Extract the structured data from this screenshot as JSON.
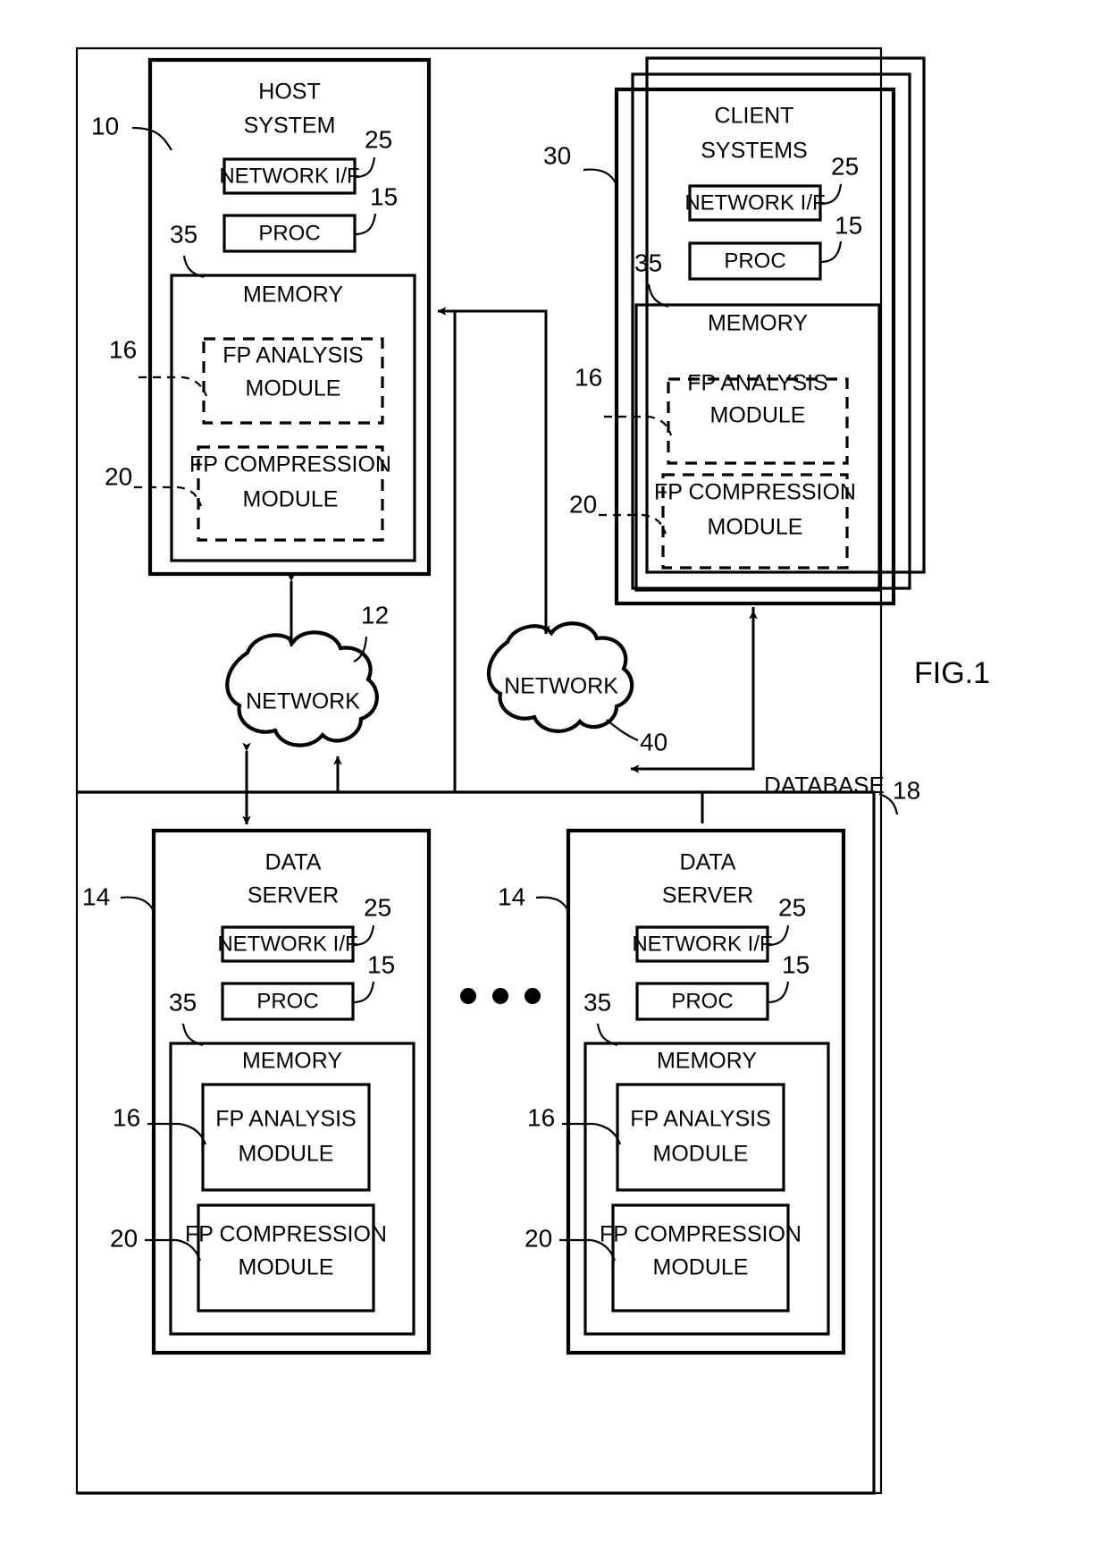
{
  "figure": {
    "label": "FIG.1",
    "outer_ref": "10",
    "database_label": "DATABASE",
    "database_ref": "18"
  },
  "nodes": {
    "host": {
      "title_line1": "HOST",
      "title_line2": "SYSTEM",
      "ref": "10",
      "network_if": {
        "label": "NETWORK I/F",
        "ref": "25"
      },
      "proc": {
        "label": "PROC",
        "ref": "15"
      },
      "memory": {
        "label": "MEMORY",
        "ref": "35",
        "modules": [
          {
            "line1": "FP ANALYSIS",
            "line2": "MODULE",
            "ref": "16",
            "border": "dashed"
          },
          {
            "line1": "FP COMPRESSION",
            "line2": "MODULE",
            "ref": "20",
            "border": "dashed"
          }
        ]
      }
    },
    "client": {
      "title_line1": "CLIENT",
      "title_line2": "SYSTEMS",
      "ref": "30",
      "network_if": {
        "label": "NETWORK I/F",
        "ref": "25"
      },
      "proc": {
        "label": "PROC",
        "ref": "15"
      },
      "memory": {
        "label": "MEMORY",
        "ref": "35",
        "modules": [
          {
            "line1": "FP ANALYSIS",
            "line2": "MODULE",
            "ref": "16",
            "border": "dashed"
          },
          {
            "line1": "FP COMPRESSION",
            "line2": "MODULE",
            "ref": "20",
            "border": "dashed"
          }
        ]
      }
    },
    "data_server_left": {
      "title_line1": "DATA",
      "title_line2": "SERVER",
      "ref": "14",
      "network_if": {
        "label": "NETWORK I/F",
        "ref": "25"
      },
      "proc": {
        "label": "PROC",
        "ref": "15"
      },
      "memory": {
        "label": "MEMORY",
        "ref": "35",
        "modules": [
          {
            "line1": "FP ANALYSIS",
            "line2": "MODULE",
            "ref": "16",
            "border": "solid"
          },
          {
            "line1": "FP COMPRESSION",
            "line2": "MODULE",
            "ref": "20",
            "border": "solid"
          }
        ]
      }
    },
    "data_server_right": {
      "title_line1": "DATA",
      "title_line2": "SERVER",
      "ref": "14",
      "network_if": {
        "label": "NETWORK I/F",
        "ref": "25"
      },
      "proc": {
        "label": "PROC",
        "ref": "15"
      },
      "memory": {
        "label": "MEMORY",
        "ref": "35",
        "modules": [
          {
            "line1": "FP ANALYSIS",
            "line2": "MODULE",
            "ref": "16",
            "border": "solid"
          },
          {
            "line1": "FP COMPRESSION",
            "line2": "MODULE",
            "ref": "20",
            "border": "solid"
          }
        ]
      }
    },
    "network_lower": {
      "label": "NETWORK",
      "ref": "12"
    },
    "network_upper": {
      "label": "NETWORK",
      "ref": "40"
    }
  },
  "ellipsis": "• • •",
  "colors": {
    "line": "#000000",
    "background": "#ffffff"
  }
}
